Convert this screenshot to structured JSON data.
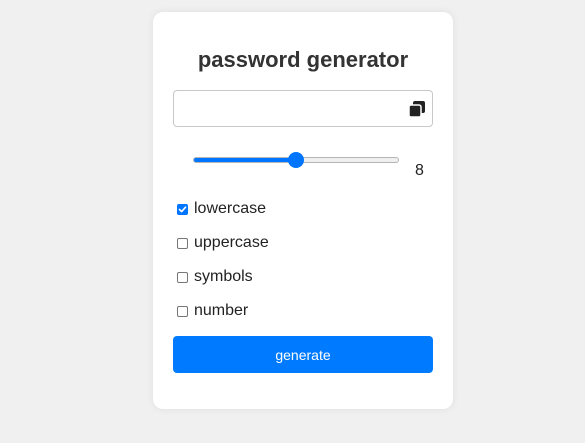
{
  "app": {
    "title": "password generator"
  },
  "password": {
    "value": "",
    "placeholder": "",
    "copy_icon": "copy-icon"
  },
  "length": {
    "value": 8,
    "min": 1,
    "max": 15,
    "display": "8"
  },
  "options": [
    {
      "label": "lowercase",
      "checked": true
    },
    {
      "label": "uppercase",
      "checked": false
    },
    {
      "label": "symbols",
      "checked": false
    },
    {
      "label": "number",
      "checked": false
    }
  ],
  "generate_label": "generate",
  "colors": {
    "accent": "#007bff",
    "slider": "#0075ff",
    "background": "#f0f0f0",
    "card": "#ffffff"
  }
}
